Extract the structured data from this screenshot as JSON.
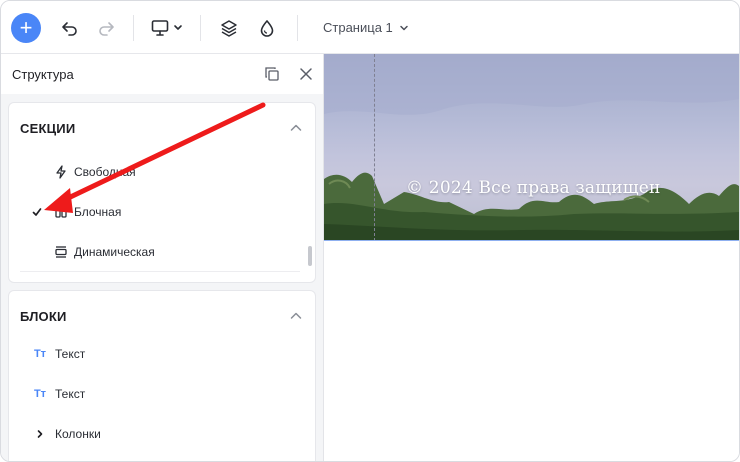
{
  "toolbar": {
    "add_icon": "plus-icon",
    "undo_icon": "undo-icon",
    "redo_icon": "redo-icon",
    "device_icon": "monitor-icon",
    "layers_icon": "layers-icon",
    "theme_icon": "drop-icon",
    "page_selector": "Страница 1"
  },
  "panel": {
    "title": "Структура",
    "sections": {
      "title": "СЕКЦИИ",
      "items": [
        {
          "label": "Свободная",
          "icon": "lightning-icon",
          "checked": false
        },
        {
          "label": "Блочная",
          "icon": "columns-icon",
          "checked": true
        },
        {
          "label": "Динамическая",
          "icon": "dynamic-section-icon",
          "checked": false
        }
      ]
    },
    "blocks": {
      "title": "БЛОКИ",
      "items": [
        {
          "label": "Текст",
          "icon": "text-icon"
        },
        {
          "label": "Текст",
          "icon": "text-icon"
        },
        {
          "label": "Колонки",
          "icon": "chevron-right-icon"
        }
      ]
    }
  },
  "canvas": {
    "footer_text": "© 2024 Все права защищен"
  },
  "colors": {
    "accent": "#4a86f7",
    "arrow": "#ee1b1b",
    "text_icon": "#4a86f7"
  }
}
